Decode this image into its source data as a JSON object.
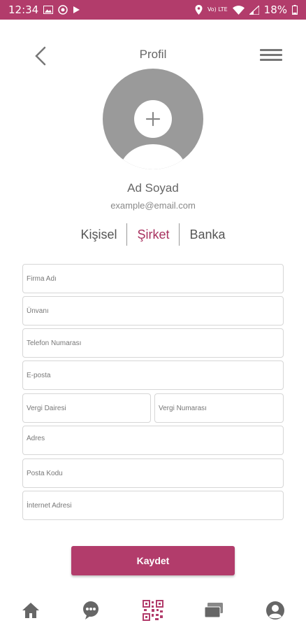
{
  "status_bar": {
    "time": "12:34",
    "battery": "18%",
    "network_badge": "Vo) LTE",
    "left_icons": [
      "image-icon",
      "whatsapp-icon",
      "play-icon"
    ],
    "right_icons": [
      "location-icon",
      "volte-icon",
      "wifi-icon",
      "signal-icon",
      "battery-icon"
    ],
    "color": "#b23c6b"
  },
  "header": {
    "title": "Profil",
    "back_icon": "chevron-left-icon",
    "menu_icon": "hamburger-menu-icon"
  },
  "profile": {
    "avatar_icon": "add-photo-icon",
    "name": "Ad Soyad",
    "email": "example@email.com"
  },
  "tabs": [
    {
      "label": "Kişisel",
      "active": false
    },
    {
      "label": "Şirket",
      "active": true
    },
    {
      "label": "Banka",
      "active": false
    }
  ],
  "form": {
    "company_name": {
      "placeholder": "Firma Adı",
      "value": ""
    },
    "title": {
      "placeholder": "Ünvanı",
      "value": ""
    },
    "phone": {
      "placeholder": "Telefon Numarası",
      "value": ""
    },
    "email": {
      "placeholder": "E-posta",
      "value": ""
    },
    "tax_office": {
      "placeholder": "Vergi Dairesi",
      "value": ""
    },
    "tax_number": {
      "placeholder": "Vergi Numarası",
      "value": ""
    },
    "address": {
      "placeholder": "Adres",
      "value": ""
    },
    "postal_code": {
      "placeholder": "Posta Kodu",
      "value": ""
    },
    "website": {
      "placeholder": "İnternet Adresi",
      "value": ""
    }
  },
  "save_label": "Kaydet",
  "bottom_nav": [
    "home-icon",
    "chat-icon",
    "qr-code-icon",
    "cards-icon",
    "profile-icon"
  ],
  "colors": {
    "accent": "#b23c6b",
    "active_tab": "#a8315f"
  }
}
